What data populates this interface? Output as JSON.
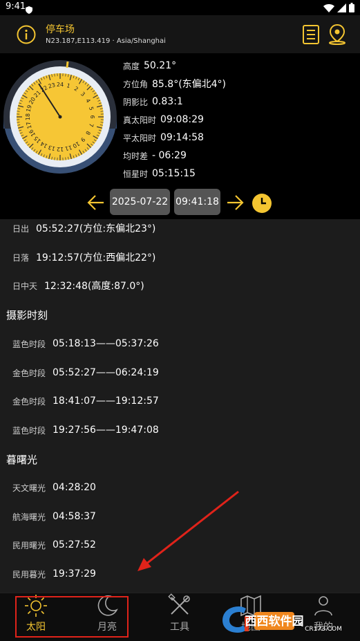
{
  "status": {
    "time": "9:41"
  },
  "header": {
    "title": "停车场",
    "coords": "N23.187,E113.419 · Asia/Shanghai"
  },
  "readouts": [
    {
      "label": "高度",
      "value": "50.21°"
    },
    {
      "label": "方位角",
      "value": "85.8°(东偏北4°)"
    },
    {
      "label": "阴影比",
      "value": "0.83:1"
    },
    {
      "label": "真太阳时",
      "value": "09:08:29"
    },
    {
      "label": "平太阳时",
      "value": "09:14:58"
    },
    {
      "label": "均时差",
      "value": "- 06:29"
    },
    {
      "label": "恒星时",
      "value": "05:15:15"
    }
  ],
  "datebar": {
    "date": "2025-07-22",
    "time": "09:41:18"
  },
  "dial": {
    "hour_labels": [
      "1",
      "2",
      "3",
      "4",
      "5",
      "6",
      "7",
      "8",
      "9",
      "10",
      "11",
      "12",
      "13",
      "14",
      "15",
      "16",
      "17",
      "18",
      "19",
      "20",
      "21",
      "22",
      "23",
      "24"
    ],
    "colors": {
      "face": "#f6c635",
      "ring": "#e8edf4",
      "hand": "#222222",
      "sky_dark": "#2a2f3a"
    }
  },
  "sun_events": [
    {
      "label": "日出",
      "value": "05:52:27(方位:东偏北23°)"
    },
    {
      "label": "日落",
      "value": "19:12:57(方位:西偏北22°)"
    },
    {
      "label": "日中天",
      "value": "12:32:48(高度:87.0°)"
    }
  ],
  "photo_section": {
    "title": "摄影时刻",
    "items": [
      {
        "label": "蓝色时段",
        "value": "05:18:13——05:37:26"
      },
      {
        "label": "金色时段",
        "value": "05:52:27——06:24:19"
      },
      {
        "label": "金色时段",
        "value": "18:41:07——19:12:57"
      },
      {
        "label": "蓝色时段",
        "value": "19:27:56——19:47:08"
      }
    ]
  },
  "twilight_section": {
    "title": "暮曙光",
    "items": [
      {
        "label": "天文曙光",
        "value": "04:28:20"
      },
      {
        "label": "航海曙光",
        "value": "04:58:37"
      },
      {
        "label": "民用曙光",
        "value": "05:27:52"
      },
      {
        "label": "民用暮光",
        "value": "19:37:29"
      }
    ]
  },
  "tabs": [
    {
      "label": "太阳"
    },
    {
      "label": "月亮"
    },
    {
      "label": "工具"
    },
    {
      "label": "地图"
    },
    {
      "label": "我的"
    }
  ],
  "watermark": {
    "text": "西西软件园",
    "sub": "CR173.COM"
  },
  "colors": {
    "accent": "#f4c531",
    "annotation": "#e0231a"
  }
}
